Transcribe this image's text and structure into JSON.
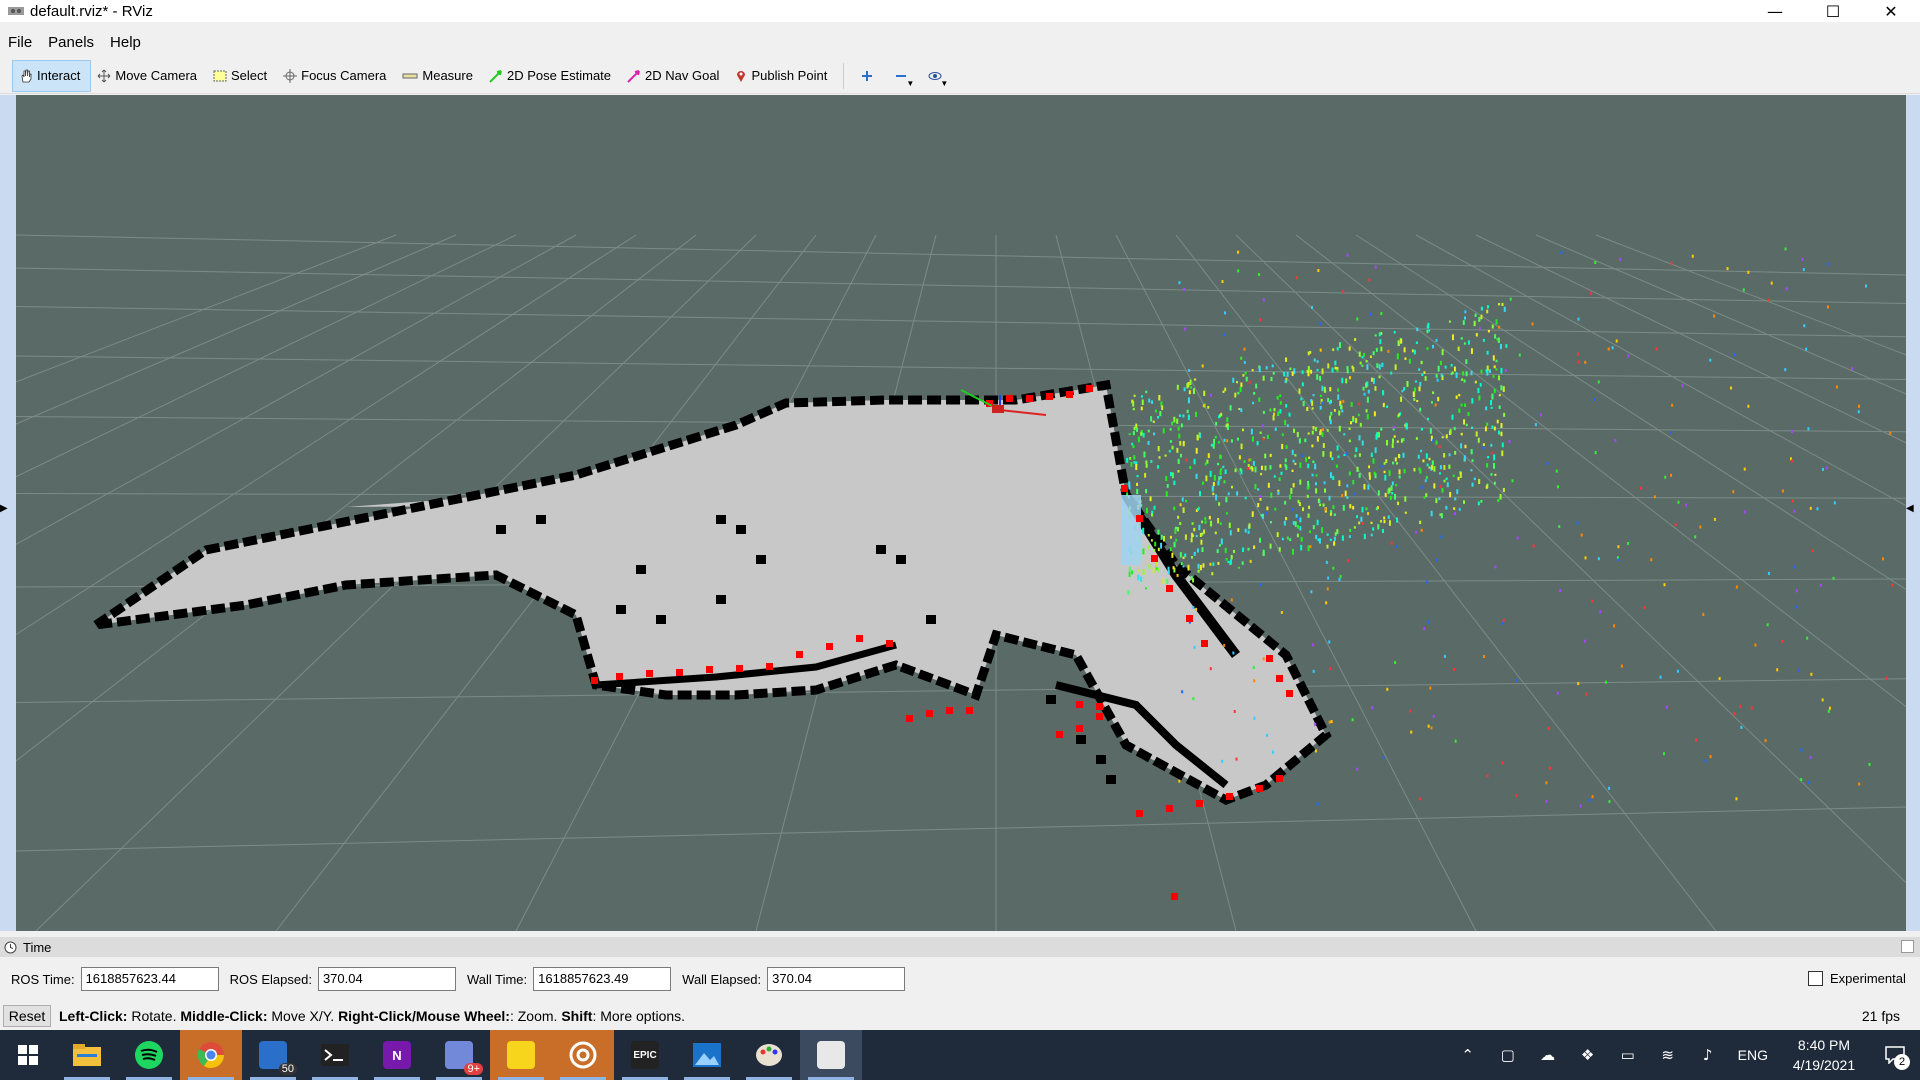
{
  "window": {
    "title": "default.rviz* - RViz",
    "minimize_glyph": "—",
    "maximize_glyph": "☐",
    "close_glyph": "✕"
  },
  "menu": [
    "File",
    "Panels",
    "Help"
  ],
  "toolbar": {
    "interact": "Interact",
    "move_camera": "Move Camera",
    "select": "Select",
    "focus_camera": "Focus Camera",
    "measure": "Measure",
    "pose_estimate": "2D Pose Estimate",
    "nav_goal": "2D Nav Goal",
    "publish_point": "Publish Point"
  },
  "time_panel": {
    "title": "Time",
    "ros_time_label": "ROS Time:",
    "ros_time": "1618857623.44",
    "ros_elapsed_label": "ROS Elapsed:",
    "ros_elapsed": "370.04",
    "wall_time_label": "Wall Time:",
    "wall_time": "1618857623.49",
    "wall_elapsed_label": "Wall Elapsed:",
    "wall_elapsed": "370.04",
    "experimental_label": "Experimental"
  },
  "status": {
    "reset_label": "Reset",
    "hint_1_bold": "Left-Click:",
    "hint_1": " Rotate. ",
    "hint_2_bold": "Middle-Click:",
    "hint_2": " Move X/Y. ",
    "hint_3_bold": "Right-Click/Mouse Wheel:",
    "hint_3": ": Zoom. ",
    "hint_4_bold": "Shift",
    "hint_4": ": More options.",
    "fps": "21 fps"
  },
  "taskbar": {
    "mail_badge": "50",
    "discord_badge": "9+",
    "epic_label": "EPIC",
    "onenote_label": "N",
    "lang": "ENG",
    "time": "8:40 PM",
    "date": "4/19/2021",
    "notification_count": "2"
  },
  "colors": {
    "viewport_bg": "#5a6b67",
    "map_free": "#c8c8c8",
    "map_occupied": "#000000",
    "laser_points": "#ff0000",
    "accent": "#cce4f7"
  }
}
